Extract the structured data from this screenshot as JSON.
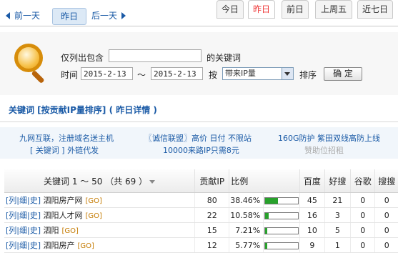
{
  "nav": {
    "prev_label": "前一天",
    "current_label": "昨日",
    "next_label": "后一天",
    "tabs": [
      "今日",
      "昨日",
      "前日",
      "上周五",
      "近七日"
    ],
    "active_tab": "昨日"
  },
  "filter": {
    "contains_label": "仅列出包含",
    "keyword_suffix": "的关键词",
    "keyword_value": "",
    "time_label": "时间",
    "date_from": "2015-2-13",
    "range_sep": "～",
    "date_to": "2015-2-13",
    "by_label": "按",
    "sort_by_value": "带来IP量",
    "order_label": "排序",
    "confirm_label": "确 定"
  },
  "section_title": "关键词 [按贡献IP量排序] ( 昨日详情 )",
  "ads": {
    "a1": "九网互联，注册域名送主机",
    "a2": "〖诚信联盟〗高价 日付 不限站",
    "a3": "160G防护 紫田双线高防上线",
    "a4": "[ 关键词 ] 外链代发",
    "a5": "10000来路IP只需8元",
    "a6": "赞助位招租"
  },
  "table": {
    "headers": {
      "keyword": "关键词 1 ～ 50 （共 69 ）",
      "ip": "贡献IP",
      "ratio": "比例",
      "baidu": "百度",
      "haosou": "好搜",
      "google": "谷歌",
      "sogou": "搜搜"
    },
    "row_links": "[列|细|史]",
    "go_label": "[GO]",
    "rows": [
      {
        "keyword": "泗阳房产网",
        "ip": "80",
        "ratio": "38.46%",
        "ratio_value": 0.3846,
        "baidu": "45",
        "haosou": "21",
        "google": "0",
        "sogou": "0"
      },
      {
        "keyword": "泗阳人才网",
        "ip": "22",
        "ratio": "10.58%",
        "ratio_value": 0.1058,
        "baidu": "16",
        "haosou": "3",
        "google": "0",
        "sogou": "0"
      },
      {
        "keyword": "泗阳",
        "ip": "15",
        "ratio": "7.21%",
        "ratio_value": 0.0721,
        "baidu": "10",
        "haosou": "5",
        "google": "0",
        "sogou": "0"
      },
      {
        "keyword": "泗阳房产",
        "ip": "12",
        "ratio": "5.77%",
        "ratio_value": 0.0577,
        "baidu": "9",
        "haosou": "1",
        "google": "0",
        "sogou": "0"
      }
    ]
  }
}
